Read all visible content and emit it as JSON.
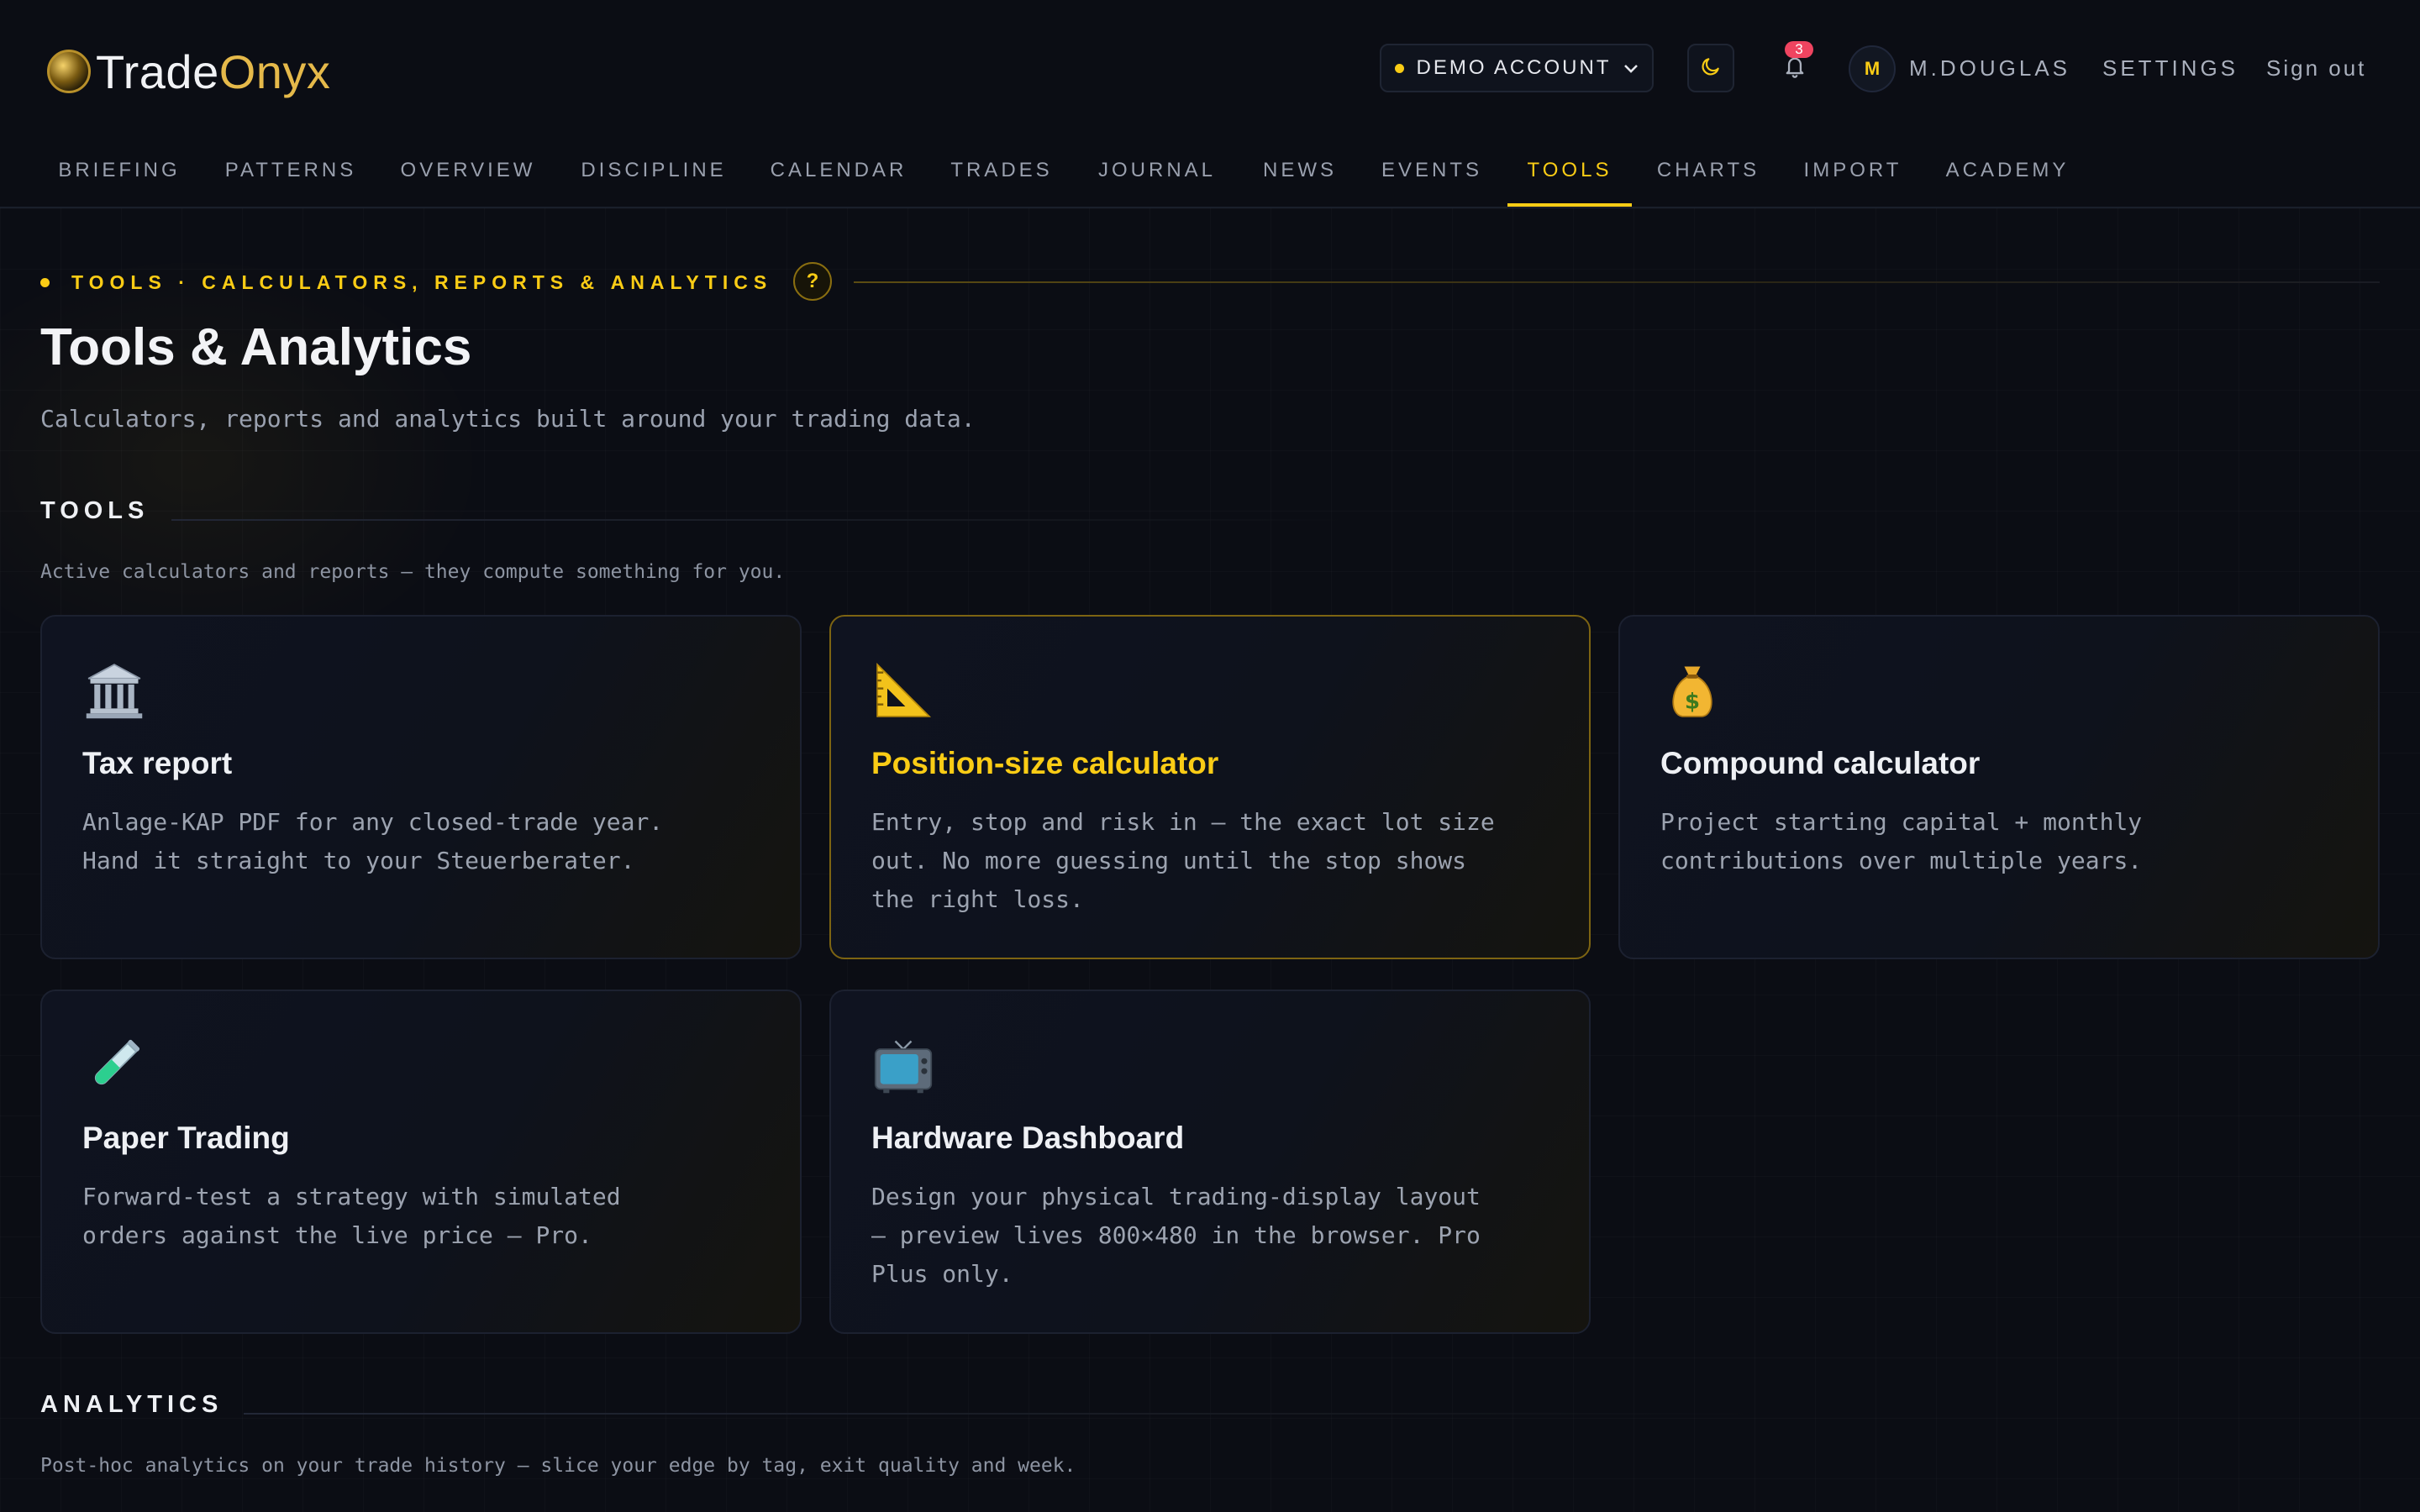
{
  "brand": {
    "name_part1": "Trade",
    "name_part2": "Onyx",
    "accent": "#facc15",
    "logo_gold": "#e5b94a"
  },
  "header": {
    "account_label": "DEMO ACCOUNT",
    "theme_icon": "moon-icon",
    "notifications_icon": "bell-icon",
    "notifications_count": "3",
    "avatar_initial": "M",
    "username": "M.DOUGLAS",
    "settings_label": "SETTINGS",
    "signout_label": "Sign out"
  },
  "nav": {
    "items": [
      {
        "label": "BRIEFING"
      },
      {
        "label": "PATTERNS"
      },
      {
        "label": "OVERVIEW"
      },
      {
        "label": "DISCIPLINE"
      },
      {
        "label": "CALENDAR"
      },
      {
        "label": "TRADES"
      },
      {
        "label": "JOURNAL"
      },
      {
        "label": "NEWS"
      },
      {
        "label": "EVENTS"
      },
      {
        "label": "TOOLS"
      },
      {
        "label": "CHARTS"
      },
      {
        "label": "IMPORT"
      },
      {
        "label": "ACADEMY"
      }
    ],
    "active": "TOOLS"
  },
  "page": {
    "eyebrow": "TOOLS · CALCULATORS, REPORTS & ANALYTICS",
    "help_label": "?",
    "title": "Tools & Analytics",
    "subtitle": "Calculators, reports and analytics built around your trading data."
  },
  "tools": {
    "heading": "TOOLS",
    "description": "Active calculators and reports — they compute something for you.",
    "cards": [
      {
        "icon": "bank-icon",
        "title": "Tax report",
        "desc": "Anlage-KAP PDF for any closed-trade year.\nHand it straight to your Steuerberater."
      },
      {
        "icon": "triangle-ruler-icon",
        "title": "Position-size calculator",
        "desc": "Entry, stop and risk in — the exact lot size\nout. No more guessing until the stop shows\nthe right loss."
      },
      {
        "icon": "money-bag-icon",
        "title": "Compound calculator",
        "desc": "Project starting capital + monthly\ncontributions over multiple years."
      },
      {
        "icon": "test-tube-icon",
        "title": "Paper Trading",
        "desc": "Forward-test a strategy with simulated\norders against the live price — Pro."
      },
      {
        "icon": "television-icon",
        "title": "Hardware Dashboard",
        "desc": "Design your physical trading-display layout\n— preview lives 800×480 in the browser. Pro\nPlus only."
      }
    ]
  },
  "analytics": {
    "heading": "ANALYTICS",
    "description": "Post-hoc analytics on your trade history — slice your edge by tag, exit quality and week."
  }
}
